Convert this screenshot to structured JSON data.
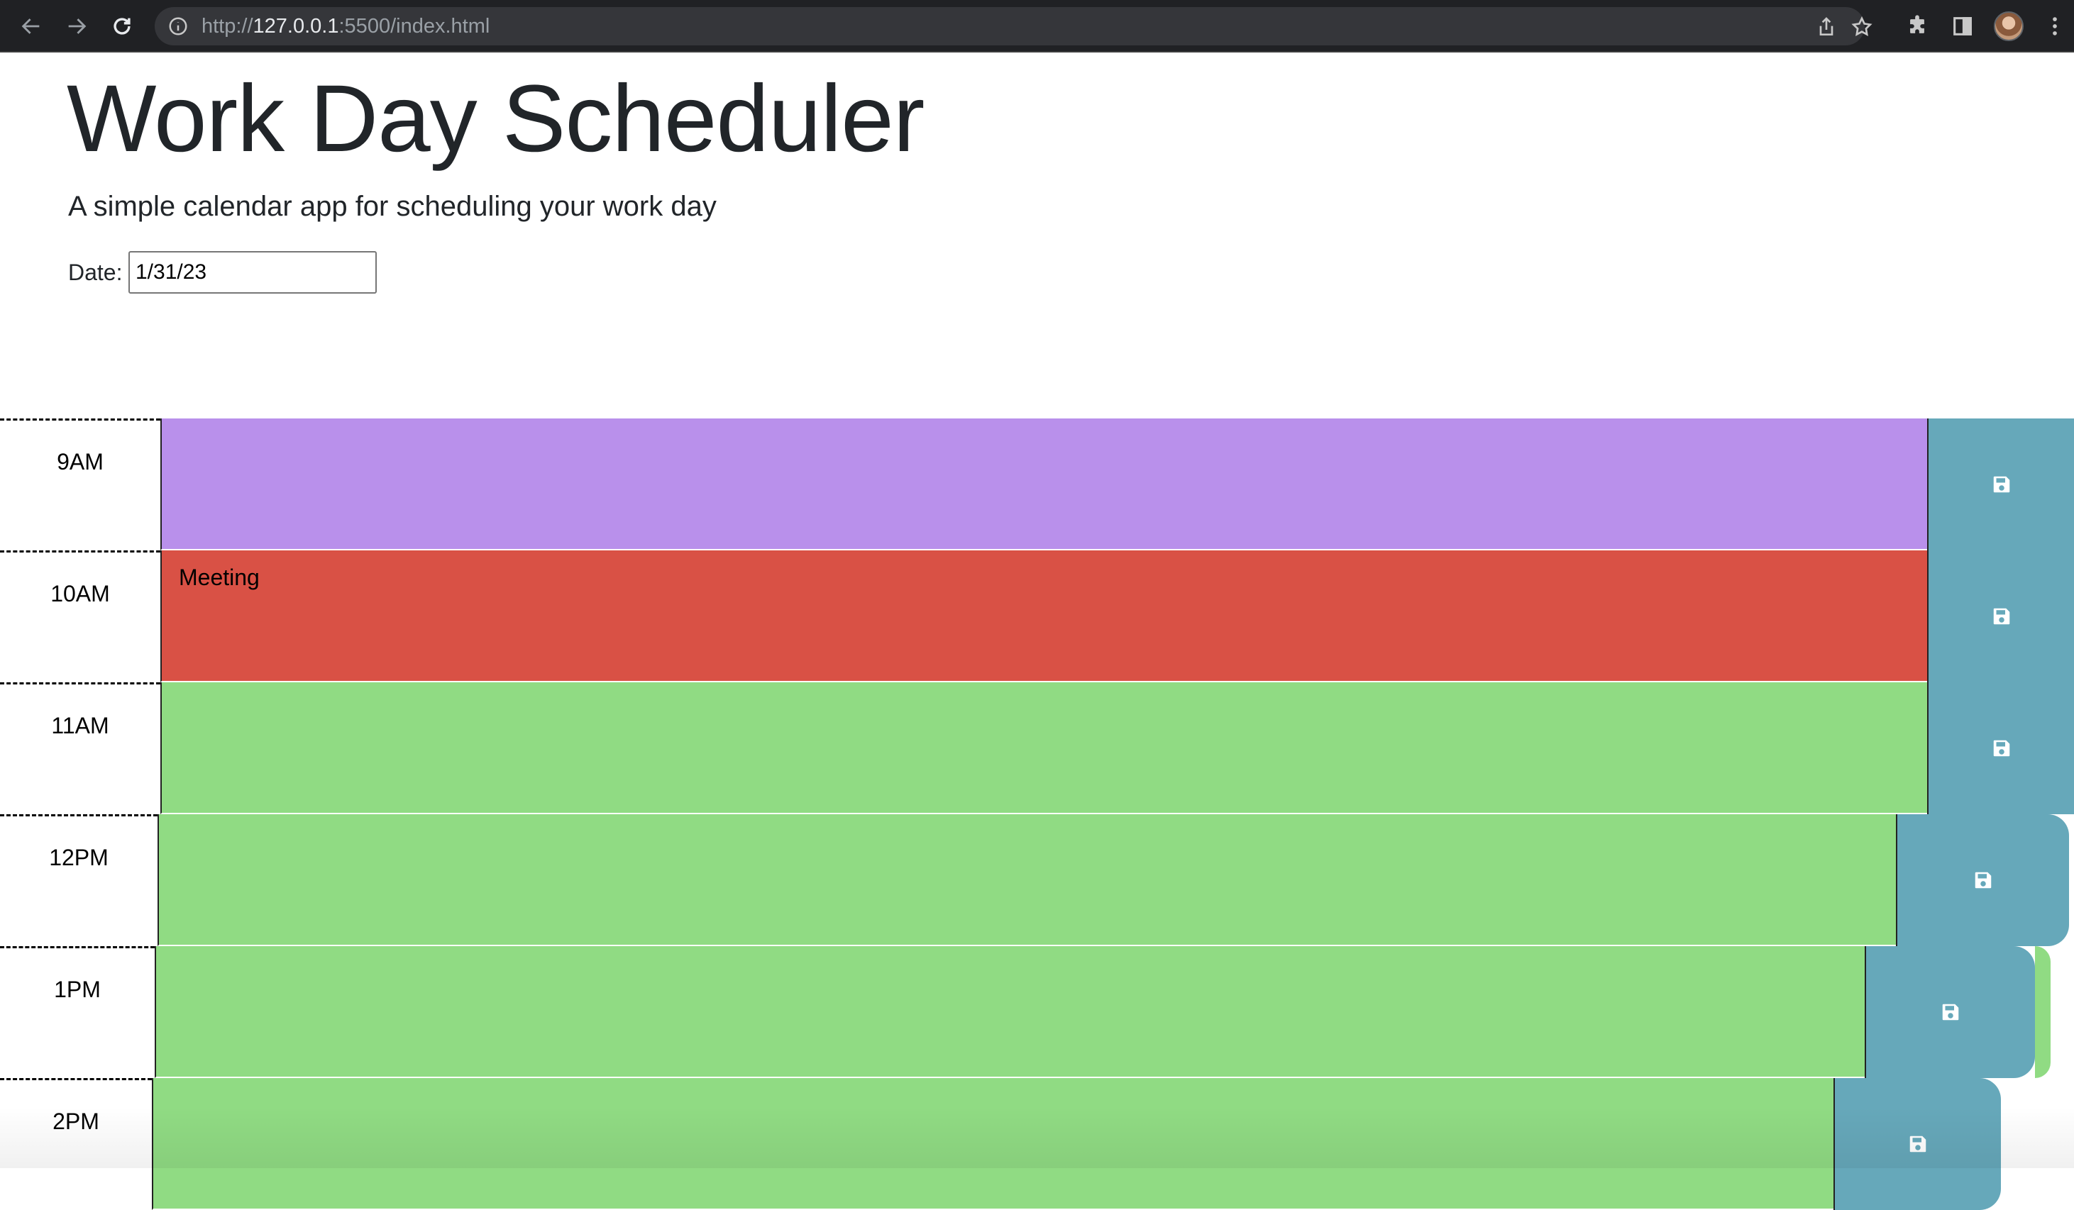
{
  "browser": {
    "url_scheme": "http://",
    "url_host": "127.0.0.1",
    "url_rest": ":5500/index.html",
    "icons": [
      "back-arrow-icon",
      "forward-arrow-icon",
      "reload-icon",
      "info-icon",
      "share-icon",
      "star-icon",
      "extensions-icon",
      "side-panel-icon",
      "profile-avatar",
      "menu-icon"
    ]
  },
  "header": {
    "title": "Work Day Scheduler",
    "lead": "A simple calendar app for scheduling your work day"
  },
  "date": {
    "label": "Date:",
    "value": "1/31/23"
  },
  "colors": {
    "past": "#b990eb",
    "present": "#d95145",
    "future": "#90db83",
    "save": "#66a8ba"
  },
  "timeblocks": [
    {
      "hour": "9AM",
      "text": "",
      "state": "past"
    },
    {
      "hour": "10AM",
      "text": "Meeting",
      "state": "present"
    },
    {
      "hour": "11AM",
      "text": "",
      "state": "future"
    },
    {
      "hour": "12PM",
      "text": "",
      "state": "future"
    },
    {
      "hour": "1PM",
      "text": "",
      "state": "future"
    },
    {
      "hour": "2PM",
      "text": "",
      "state": "future"
    }
  ],
  "save_icon": "floppy-disk-icon"
}
